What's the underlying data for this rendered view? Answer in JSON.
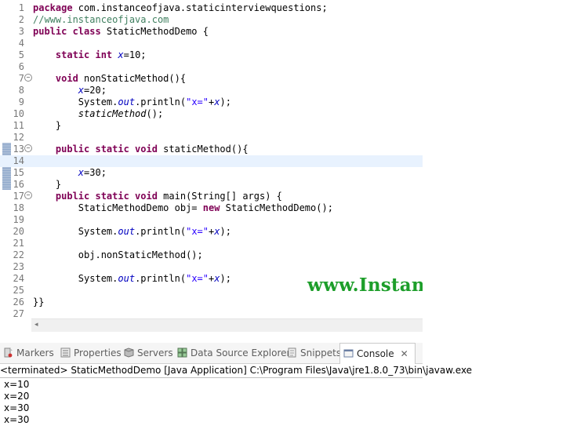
{
  "editor": {
    "lines": [
      {
        "n": "1",
        "html": "<span class='kw'>package</span> com.instanceofjava.staticinterviewquestions;"
      },
      {
        "n": "2",
        "html": "<span class='cmt'>//www.instanceofjava.com</span>"
      },
      {
        "n": "3",
        "html": "<span class='kw'>public class</span> StaticMethodDemo {"
      },
      {
        "n": "4",
        "html": ""
      },
      {
        "n": "5",
        "html": "    <span class='kw'>static int</span> <span class='field'>x</span>=10;"
      },
      {
        "n": "6",
        "html": ""
      },
      {
        "n": "7",
        "html": "    <span class='kw'>void</span> nonStaticMethod(){"
      },
      {
        "n": "8",
        "html": "        <span class='field'>x</span>=20;"
      },
      {
        "n": "9",
        "html": "        System.<span class='field'>out</span>.println(<span class='str'>\"x=\"</span>+<span class='field'>x</span>);"
      },
      {
        "n": "10",
        "html": "        <span class='italic'>staticMethod</span>();"
      },
      {
        "n": "11",
        "html": "    }"
      },
      {
        "n": "12",
        "html": ""
      },
      {
        "n": "13",
        "html": "    <span class='kw'>public static void</span> staticMethod(){"
      },
      {
        "n": "14",
        "html": ""
      },
      {
        "n": "15",
        "html": "        <span class='field'>x</span>=30;"
      },
      {
        "n": "16",
        "html": "    }"
      },
      {
        "n": "17",
        "html": "    <span class='kw'>public static void</span> main(String[] args) {"
      },
      {
        "n": "18",
        "html": "        StaticMethodDemo obj= <span class='kw'>new</span> StaticMethodDemo();"
      },
      {
        "n": "19",
        "html": ""
      },
      {
        "n": "20",
        "html": "        System.<span class='field'>out</span>.println(<span class='str'>\"x=\"</span>+<span class='field'>x</span>);"
      },
      {
        "n": "21",
        "html": ""
      },
      {
        "n": "22",
        "html": "        obj.nonStaticMethod();"
      },
      {
        "n": "23",
        "html": ""
      },
      {
        "n": "24",
        "html": "        System.<span class='field'>out</span>.println(<span class='str'>\"x=\"</span>+<span class='field'>x</span>);"
      },
      {
        "n": "25",
        "html": ""
      },
      {
        "n": "26",
        "html": "}}"
      },
      {
        "n": "27",
        "html": ""
      }
    ],
    "fold_lines": [
      "7",
      "13",
      "17"
    ],
    "current_line": "14",
    "scroll_left_glyph": "◂"
  },
  "watermark": "www.InstanceofJava.com",
  "panel": {
    "tabs": [
      {
        "label": "Markers",
        "icon": "markers-icon"
      },
      {
        "label": "Properties",
        "icon": "properties-icon"
      },
      {
        "label": "Servers",
        "icon": "servers-icon"
      },
      {
        "label": "Data Source Explorer",
        "icon": "data-source-icon"
      },
      {
        "label": "Snippets",
        "icon": "snippets-icon"
      },
      {
        "label": "Console",
        "icon": "console-icon"
      }
    ],
    "close_glyph": "✕",
    "console_header": "<terminated> StaticMethodDemo [Java Application] C:\\Program Files\\Java\\jre1.8.0_73\\bin\\javaw.exe",
    "output": [
      "x=10",
      "x=20",
      "x=30",
      "x=30"
    ]
  },
  "colors": {
    "keyword": "#7f0055",
    "string": "#2a00ff",
    "comment": "#3f7f5f",
    "field": "#0000c0",
    "watermark": "#1d9e2a"
  }
}
